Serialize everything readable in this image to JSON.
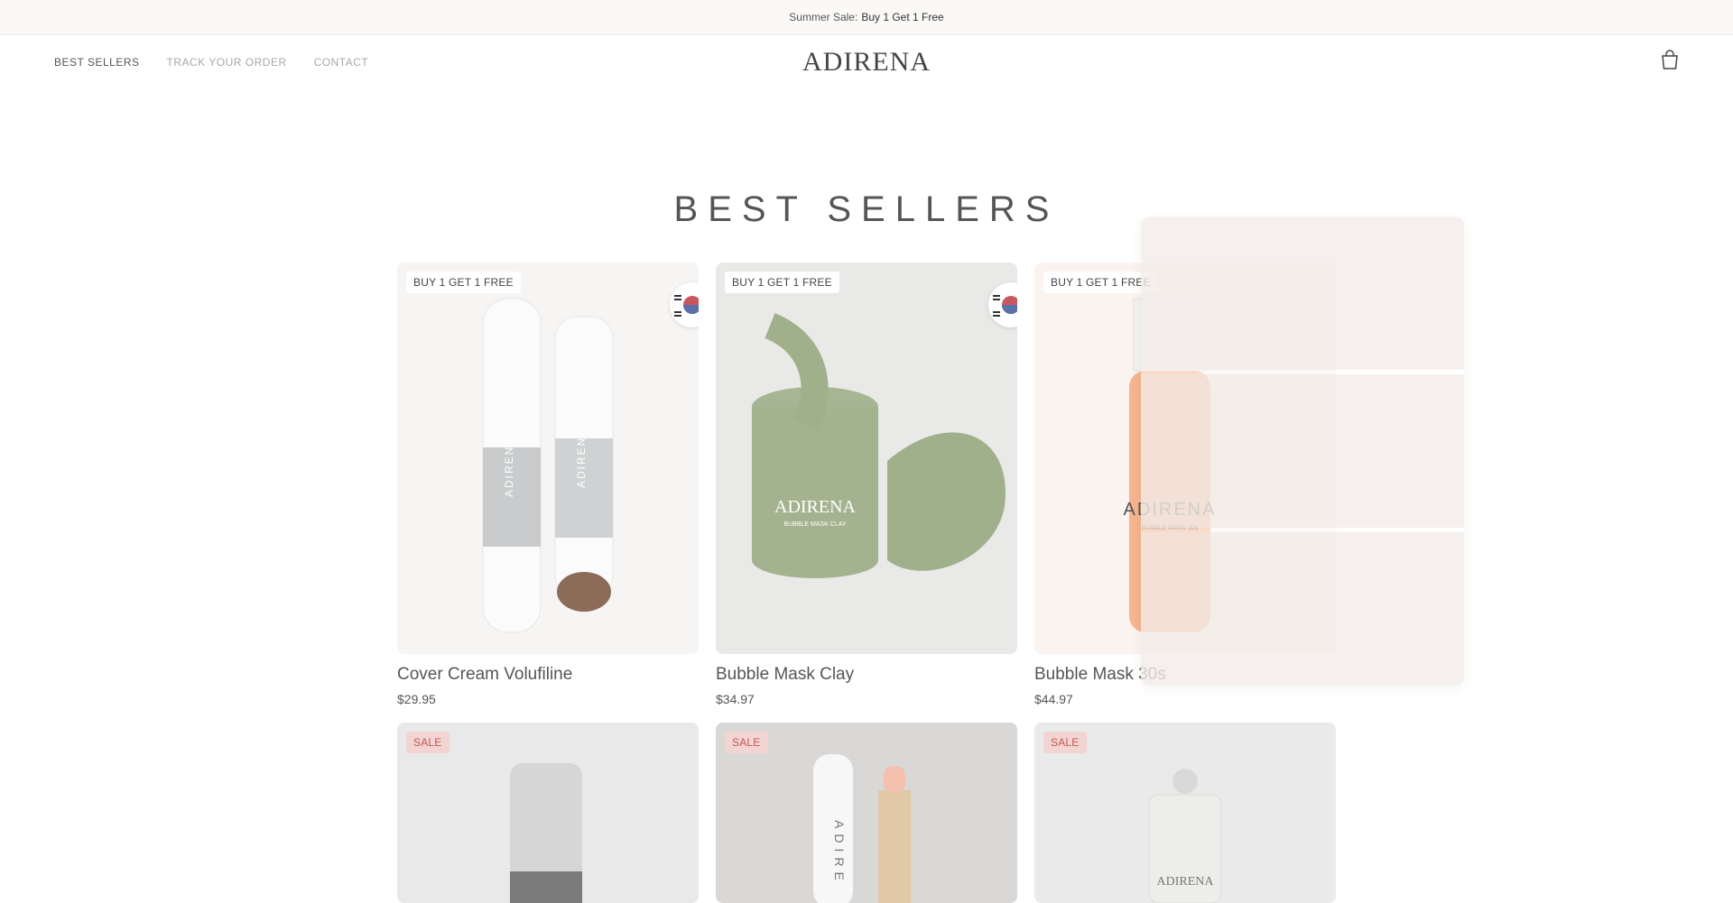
{
  "announcement": {
    "prefix": "Summer Sale:",
    "highlight": "Buy 1 Get 1 Free"
  },
  "nav": {
    "items": [
      {
        "label": "BEST SELLERS"
      },
      {
        "label": "TRACK YOUR ORDER"
      },
      {
        "label": "CONTACT"
      }
    ]
  },
  "brand": {
    "name": "ADIRENA"
  },
  "icons": {
    "cart": "shopping-bag-icon",
    "flag": "korea-flag-icon"
  },
  "section": {
    "title": "BEST SELLERS"
  },
  "products_row1": [
    {
      "badge": "BUY 1 GET 1 FREE",
      "name": "Cover Cream Volufiline",
      "price": "$29.95"
    },
    {
      "badge": "BUY 1 GET 1 FREE",
      "name": "Bubble Mask Clay",
      "price": "$34.97"
    },
    {
      "badge": "BUY 1 GET 1 FREE",
      "name": "Bubble Mask 30s",
      "price": "$44.97"
    }
  ],
  "products_row2": [
    {
      "badge": "SALE"
    },
    {
      "badge": "SALE"
    },
    {
      "badge": "SALE"
    }
  ],
  "product_image_text": {
    "cover_cream": "ADIRENA",
    "clay_jar": "ADIRENA",
    "clay_sub": "BUBBLE MASK CLAY",
    "bubble_mask": "ADIRENA",
    "bubble_sub": "BUBBLE MASK 30s",
    "lip": "ADIRE",
    "roller": "ADIRENA"
  },
  "colors": {
    "accent": "#333333",
    "badge_sale": "#c55a52",
    "clay_green": "#9fb08b"
  }
}
